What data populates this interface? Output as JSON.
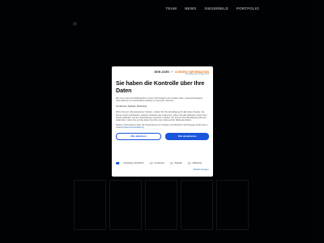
{
  "nav": {
    "items": [
      "TEAM",
      "NEWS",
      "SIEGERBILD",
      "PORTFOLIO"
    ]
  },
  "consent": {
    "brand_main": "one.com",
    "brand_x": "×",
    "brand_partner": "CONSENT INFORMATION",
    "brand_sub": "Einwilligungsmanagement",
    "title": "Sie haben die Kontrolle über Ihre Daten",
    "intro": "Wir und unsere Geschäftspartner nutzen Technologien wie Cookies dazu, personenbezogene Informationen für verschiedene Zwecke zu sammeln, darunter:",
    "purposes": "Funktional, Statistik, Marketing",
    "body": "Wenn Sie auf „Alle akzeptieren“ klicken, erteilen Sie Ihre Einwilligung für alle diese Zwecke. Sie können auch entscheiden, welchen Zwecken Sie zustimmen, indem Sie das Kästchen neben dem Zweck anklicken und auf „Einstellungen speichern“ klicken. Sie können Ihre Einwilligung jederzeit widerrufen, indem Sie auf das kleine Symbol unten links auf der Webseite klicken.",
    "more": "Weitere Informationen über die Verwendung von Cookies und ähnlichen Technologien finden Sie in unserer",
    "more_link": "Datenschutzerklärung",
    "reject": "Alle ablehnen",
    "accept": "Alle akzeptieren",
    "toggles": [
      {
        "label": "Unbedingt erforderlich",
        "on": true
      },
      {
        "label": "Funktional",
        "on": false
      },
      {
        "label": "Statistik",
        "on": false
      },
      {
        "label": "Marketing",
        "on": false
      }
    ],
    "details": "Details anzeigen"
  }
}
